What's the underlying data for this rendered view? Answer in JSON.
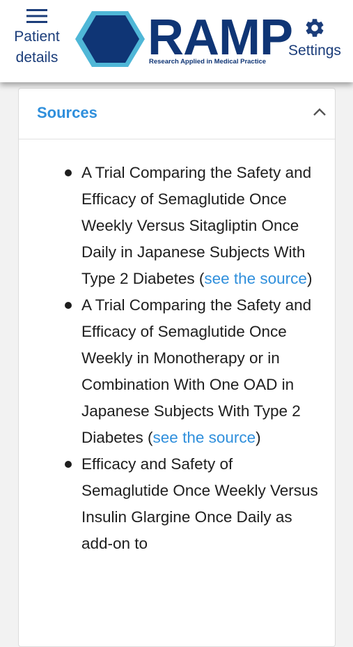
{
  "header": {
    "patient_label_line1": "Patient",
    "patient_label_line2": "details",
    "settings_label": "Settings",
    "logo_word": "RAMP",
    "logo_tagline": "Research Applied in Medical Practice",
    "icons": {
      "menu": "hamburger-menu-icon",
      "settings": "gear-icon",
      "logo": "hexagon-logo-icon"
    },
    "colors": {
      "brand_navy": "#0f3575",
      "brand_teal": "#4fb7d7",
      "link_blue": "#2f8fdc"
    }
  },
  "sources": {
    "title": "Sources",
    "expanded": true,
    "items": [
      {
        "text": "A Trial Comparing the Safety and Efficacy of Semaglutide Once Weekly Versus Sitagliptin Once Daily in Japanese Subjects With Type 2 Diabetes (",
        "link": "see the source",
        "suffix": ")"
      },
      {
        "text": "A Trial Comparing the Safety and Efficacy of Semaglutide Once Weekly in Monotherapy or in Combination With One OAD in Japanese Subjects With Type 2 Diabetes (",
        "link": "see the source",
        "suffix": ")"
      },
      {
        "text": "Efficacy and Safety of Semaglutide Once Weekly Versus Insulin Glargine Once Daily as add-on to",
        "link": "",
        "suffix": ""
      }
    ]
  }
}
